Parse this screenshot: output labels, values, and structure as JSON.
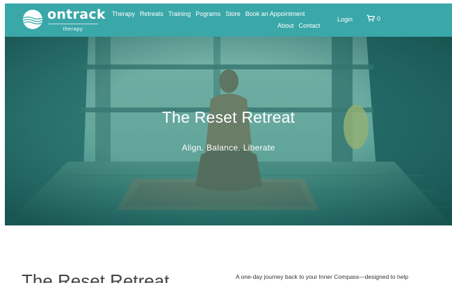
{
  "brand": {
    "name": "ontrack",
    "tagline": "therapy"
  },
  "nav": {
    "primary": [
      "Therapy",
      "Retreats",
      "Training",
      "Pograms",
      "Store",
      "Book an Appointment"
    ],
    "secondary": [
      "About",
      "Contact"
    ],
    "login": "Login",
    "cart_count": "0"
  },
  "hero": {
    "title": "The Reset Retreat",
    "subtitle": "Align. Balance. Liberate"
  },
  "intro": {
    "title": "The Reset Retreat",
    "text": "A one-day journey back to your Inner Compass—designed to help"
  },
  "colors": {
    "header_bg": "#3aa7a8",
    "hero_overlay": "#2a8a86"
  }
}
